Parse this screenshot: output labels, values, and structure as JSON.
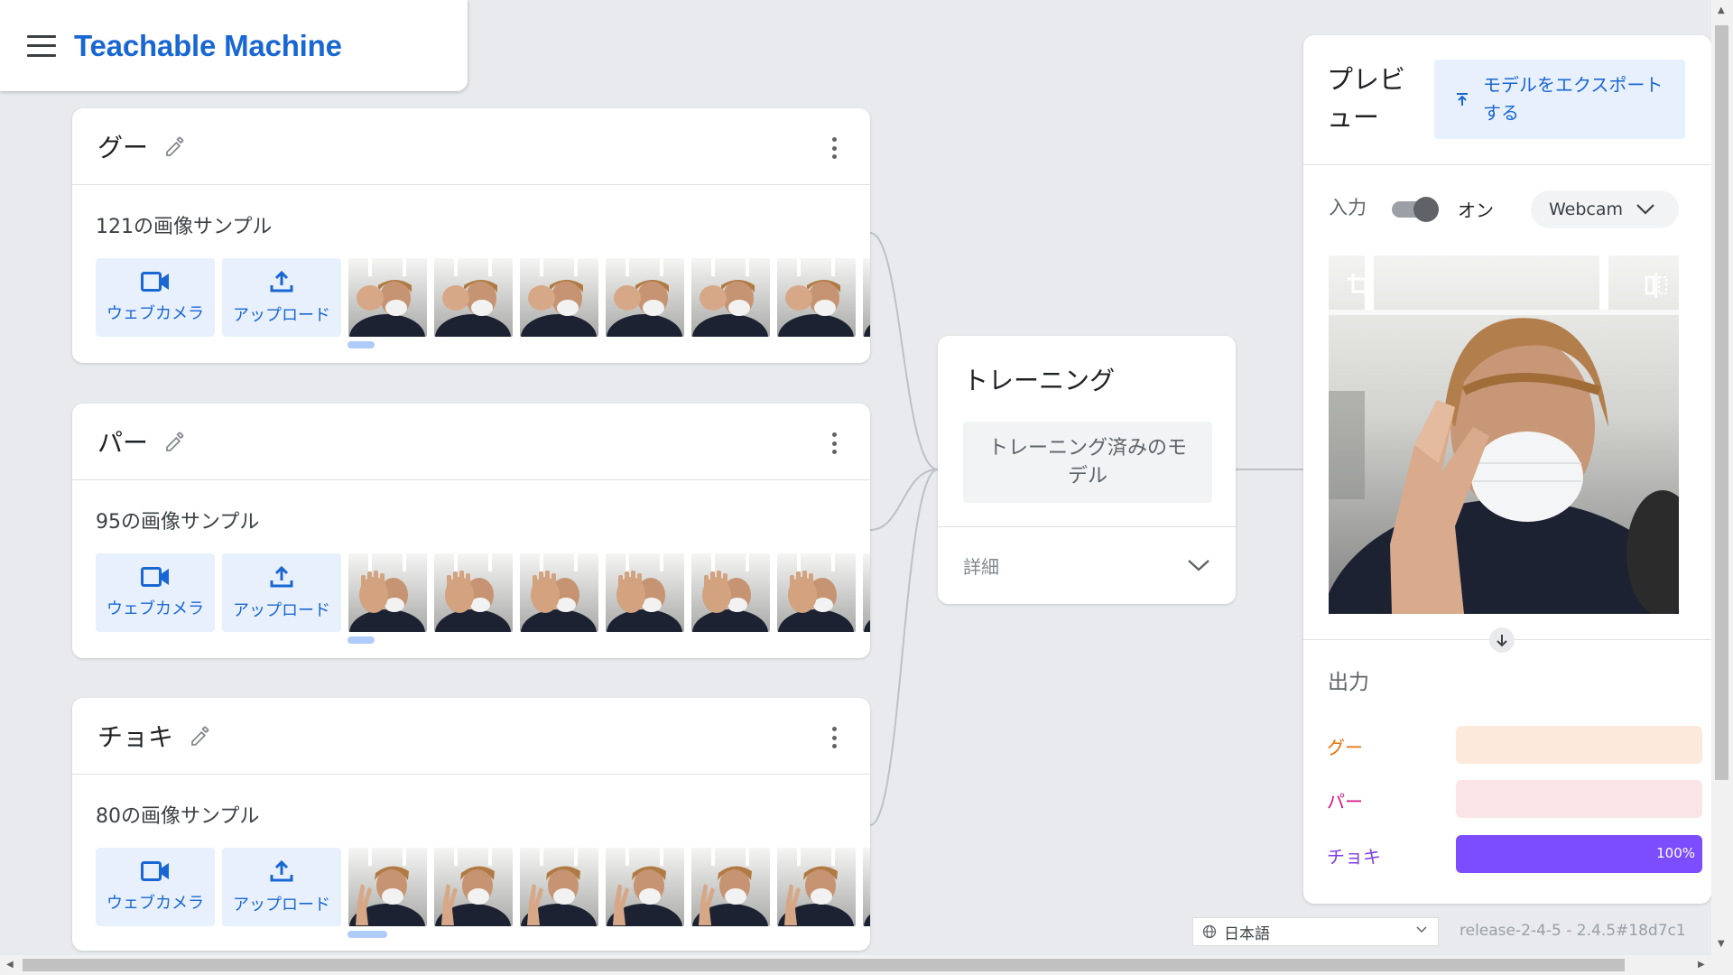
{
  "header": {
    "title": "Teachable Machine"
  },
  "classes": [
    {
      "name": "グー",
      "sample_count": "121の画像サンプル",
      "webcam_label": "ウェブカメラ",
      "upload_label": "アップロード"
    },
    {
      "name": "パー",
      "sample_count": "95の画像サンプル",
      "webcam_label": "ウェブカメラ",
      "upload_label": "アップロード"
    },
    {
      "name": "チョキ",
      "sample_count": "80の画像サンプル",
      "webcam_label": "ウェブカメラ",
      "upload_label": "アップロード"
    }
  ],
  "training": {
    "title": "トレーニング",
    "button_label": "トレーニング済みのモデル",
    "details_label": "詳細"
  },
  "preview": {
    "title": "プレビュー",
    "export_label": "モデルをエクスポートする",
    "input_label": "入力",
    "toggle_state": "オン",
    "source_select": "Webcam",
    "output_label": "出力",
    "outputs": [
      {
        "name": "グー",
        "color": "#e8710a",
        "bg": "#fde9dc",
        "fill": "#e8710a",
        "value": 0,
        "pct_label": ""
      },
      {
        "name": "パー",
        "color": "#d01884",
        "bg": "#fbe4e7",
        "fill": "#d01884",
        "value": 0,
        "pct_label": ""
      },
      {
        "name": "チョキ",
        "color": "#7b3fe4",
        "bg": "#ede4fb",
        "fill": "#7c4dff",
        "value": 1.0,
        "pct_label": "100%"
      }
    ]
  },
  "footer": {
    "language": "日本語",
    "release": "release-2-4-5 - 2.4.5#18d7c1"
  },
  "colors": {
    "accent": "#1967d2",
    "background": "#e8eaed"
  }
}
